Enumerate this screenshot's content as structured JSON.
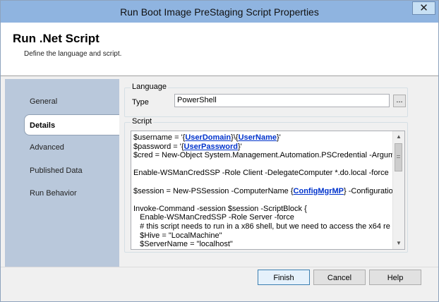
{
  "window": {
    "title": "Run Boot Image PreStaging Script Properties",
    "close_glyph": "✕"
  },
  "header": {
    "title": "Run .Net Script",
    "subtitle": "Define the language and script."
  },
  "nav": {
    "items": [
      {
        "label": "General"
      },
      {
        "label": "Details",
        "selected": true
      },
      {
        "label": "Advanced"
      },
      {
        "label": "Published Data"
      },
      {
        "label": "Run Behavior"
      }
    ]
  },
  "language_group": {
    "label": "Language",
    "type_label": "Type",
    "type_value": "PowerShell",
    "browse_label": "..."
  },
  "script_group": {
    "label": "Script",
    "lines": [
      [
        {
          "t": "$username = '"
        },
        {
          "t": "{"
        },
        {
          "t": "UserDomain",
          "v": true
        },
        {
          "t": "}\\{"
        },
        {
          "t": "UserName",
          "v": true
        },
        {
          "t": "}'"
        }
      ],
      [
        {
          "t": "$password = '"
        },
        {
          "t": "{"
        },
        {
          "t": "UserPassword",
          "v": true
        },
        {
          "t": "}'"
        }
      ],
      [
        {
          "t": "$cred = New-Object System.Management.Automation.PSCredential -Argume"
        }
      ],
      [
        {
          "t": ""
        }
      ],
      [
        {
          "t": "Enable-WSManCredSSP -Role Client -DelegateComputer *.do.local -force"
        }
      ],
      [
        {
          "t": ""
        }
      ],
      [
        {
          "t": "$session = New-PSSession -ComputerName "
        },
        {
          "t": "{"
        },
        {
          "t": "ConfigMgrMP",
          "v": true
        },
        {
          "t": "} -Configuration"
        }
      ],
      [
        {
          "t": ""
        }
      ],
      [
        {
          "t": "Invoke-Command -session $session -ScriptBlock {"
        }
      ],
      [
        {
          "t": "   Enable-WSManCredSSP -Role Server -force"
        }
      ],
      [
        {
          "t": "   # this script needs to run in a x86 shell, but we need to access the x64 re"
        }
      ],
      [
        {
          "t": "   $Hive = \"LocalMachine\""
        }
      ],
      [
        {
          "t": "   $ServerName = \"localhost\""
        }
      ]
    ]
  },
  "buttons": {
    "finish": "Finish",
    "cancel": "Cancel",
    "help": "Help"
  },
  "colors": {
    "titlebar": "#8fb4e0",
    "nav_background": "#b9c8db",
    "variable_link": "#0033cc"
  }
}
